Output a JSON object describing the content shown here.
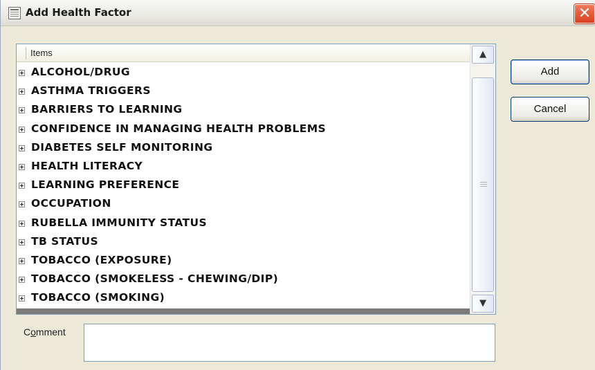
{
  "window": {
    "title": "Add Health Factor",
    "close_glyph": "✕"
  },
  "list": {
    "header": "Items",
    "items": [
      {
        "label": "ALCOHOL/DRUG"
      },
      {
        "label": "ASTHMA TRIGGERS"
      },
      {
        "label": "BARRIERS TO LEARNING"
      },
      {
        "label": "CONFIDENCE IN MANAGING HEALTH PROBLEMS"
      },
      {
        "label": "DIABETES SELF MONITORING"
      },
      {
        "label": "HEALTH LITERACY"
      },
      {
        "label": "LEARNING PREFERENCE"
      },
      {
        "label": "OCCUPATION"
      },
      {
        "label": "RUBELLA IMMUNITY STATUS"
      },
      {
        "label": "TB STATUS"
      },
      {
        "label": "TOBACCO (EXPOSURE)"
      },
      {
        "label": "TOBACCO (SMOKELESS - CHEWING/DIP)"
      },
      {
        "label": "TOBACCO (SMOKING)"
      }
    ],
    "scroll_up_glyph": "▲",
    "scroll_down_glyph": "▼"
  },
  "buttons": {
    "add": "Add",
    "cancel": "Cancel"
  },
  "comment": {
    "label": "Comment",
    "value": ""
  },
  "colors": {
    "dialog_bg": "#ece9d8",
    "close_red": "#d8401e",
    "field_border": "#7f9db9"
  }
}
